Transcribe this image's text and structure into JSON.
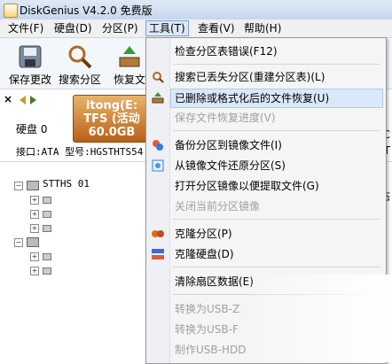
{
  "window": {
    "title": "DiskGenius V4.2.0 免费版"
  },
  "menubar": {
    "items": [
      {
        "label": "文件(F)"
      },
      {
        "label": "硬盘(D)"
      },
      {
        "label": "分区(P)"
      },
      {
        "label": "工具(T)",
        "active": true
      },
      {
        "label": "查看(V)"
      },
      {
        "label": "帮助(H)"
      }
    ]
  },
  "toolbar": {
    "items": [
      {
        "label": "保存更改",
        "icon": "save-icon"
      },
      {
        "label": "搜索分区",
        "icon": "magnifier-icon"
      },
      {
        "label": "恢复文",
        "icon": "recover-icon"
      }
    ]
  },
  "disk_panel": {
    "disk_label": "硬盘 0",
    "partition_lines": [
      "itong(E:",
      "TFS (活动",
      "60.0GB"
    ],
    "interface_line": "接口:ATA  型号:HGSTHTS54",
    "right_fragments": [
      "C",
      "T"
    ]
  },
  "tree": {
    "partial_label": "    STTHS   01",
    "right_header": "态"
  },
  "tools_menu": {
    "items": [
      {
        "label": "检查分区表错误(F12)",
        "enabled": true,
        "icon": ""
      },
      {
        "label": "搜索已丢失分区(重建分区表)(L)",
        "enabled": true,
        "icon": "search-partition-icon"
      },
      {
        "label": "已删除或格式化后的文件恢复(U)",
        "enabled": true,
        "icon": "file-recover-icon",
        "highlighted": true
      },
      {
        "label": "保存文件恢复进度(V)",
        "enabled": false,
        "icon": ""
      },
      {
        "label": "备份分区到镜像文件(I)",
        "enabled": true,
        "icon": "backup-image-icon"
      },
      {
        "label": "从镜像文件还原分区(S)",
        "enabled": true,
        "icon": "restore-image-icon"
      },
      {
        "label": "打开分区镜像以便提取文件(G)",
        "enabled": true,
        "icon": ""
      },
      {
        "label": "关闭当前分区镜像",
        "enabled": false,
        "icon": ""
      },
      {
        "label": "克隆分区(P)",
        "enabled": true,
        "icon": "clone-partition-icon"
      },
      {
        "label": "克隆硬盘(D)",
        "enabled": true,
        "icon": "clone-disk-icon"
      },
      {
        "label": "清除扇区数据(E)",
        "enabled": true,
        "icon": ""
      },
      {
        "label": "转换为USB-Z",
        "enabled": false,
        "icon": ""
      },
      {
        "label": "转换为USB-F",
        "enabled": false,
        "icon": ""
      },
      {
        "label": "制作USB-HDD",
        "enabled": false,
        "icon": ""
      }
    ]
  },
  "colors": {
    "menu_highlight": "#dbe8f8",
    "disk_bar": "#c87830",
    "disabled_text": "#a0a0a0"
  }
}
